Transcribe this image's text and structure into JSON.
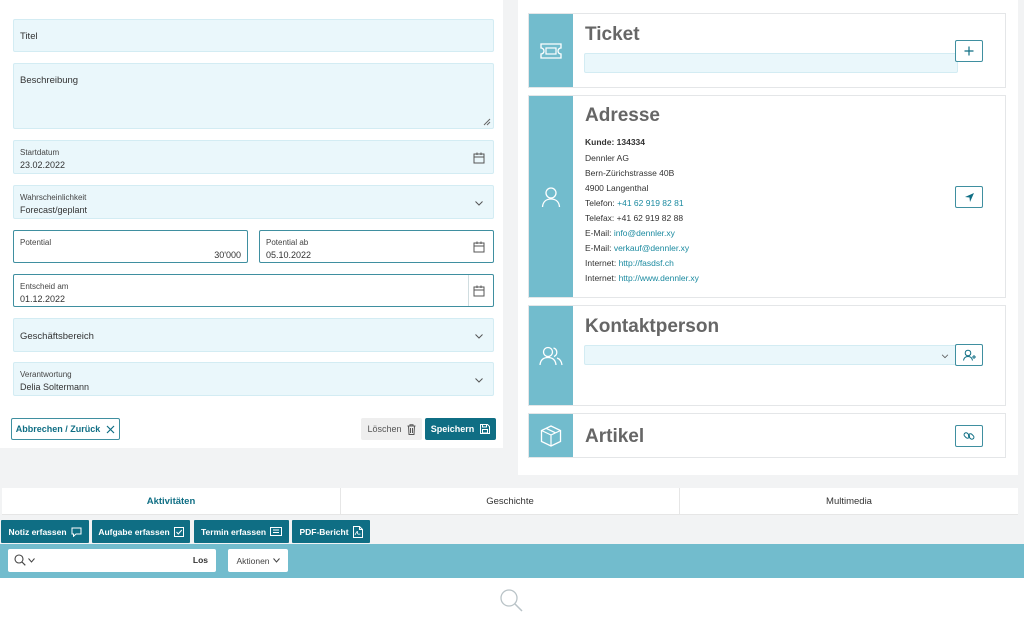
{
  "form": {
    "titel_placeholder": "Titel",
    "beschreibung_placeholder": "Beschreibung",
    "startdatum_label": "Startdatum",
    "startdatum_value": "23.02.2022",
    "wahrscheinlichkeit_label": "Wahrscheinlichkeit",
    "wahrscheinlichkeit_value": "Forecast/geplant",
    "potential_label": "Potential",
    "potential_value": "30'000",
    "potential_ab_label": "Potential ab",
    "potential_ab_value": "05.10.2022",
    "entscheid_label": "Entscheid am",
    "entscheid_value": "01.12.2022",
    "geschaeftsbereich_placeholder": "Geschäftsbereich",
    "verantwortung_label": "Verantwortung",
    "verantwortung_value": "Delia Soltermann",
    "cancel_label": "Abbrechen / Zurück",
    "delete_label": "Löschen",
    "save_label": "Speichern"
  },
  "ticket": {
    "title": "Ticket"
  },
  "adresse": {
    "title": "Adresse",
    "kunde": "Kunde: 134334",
    "name": "Dennler AG",
    "street": "Bern-Zürichstrasse 40B",
    "city": "4900 Langenthal",
    "telefon_label": "Telefon:",
    "telefon_value": "+41 62 919 82 81",
    "telefax_label": "Telefax:",
    "telefax_value": "+41 62 919 82 88",
    "email1_label": "E-Mail:",
    "email1_value": "info@dennler.xy",
    "email2_label": "E-Mail:",
    "email2_value": "verkauf@dennler.xy",
    "internet1_label": "Internet:",
    "internet1_value": "http://fasdsf.ch",
    "internet2_label": "Internet:",
    "internet2_value": "http://www.dennler.xy"
  },
  "kontakt": {
    "title": "Kontaktperson"
  },
  "artikel": {
    "title": "Artikel"
  },
  "tabs": {
    "aktivitaeten": "Aktivitäten",
    "geschichte": "Geschichte",
    "multimedia": "Multimedia"
  },
  "actions": {
    "notiz": "Notiz erfassen",
    "aufgabe": "Aufgabe erfassen",
    "termin": "Termin erfassen",
    "pdf": "PDF-Bericht"
  },
  "toolbar": {
    "los": "Los",
    "aktionen": "Aktionen"
  },
  "colors": {
    "accent": "#0f6e84",
    "side": "#72bccd",
    "field": "#eaf7fb"
  }
}
